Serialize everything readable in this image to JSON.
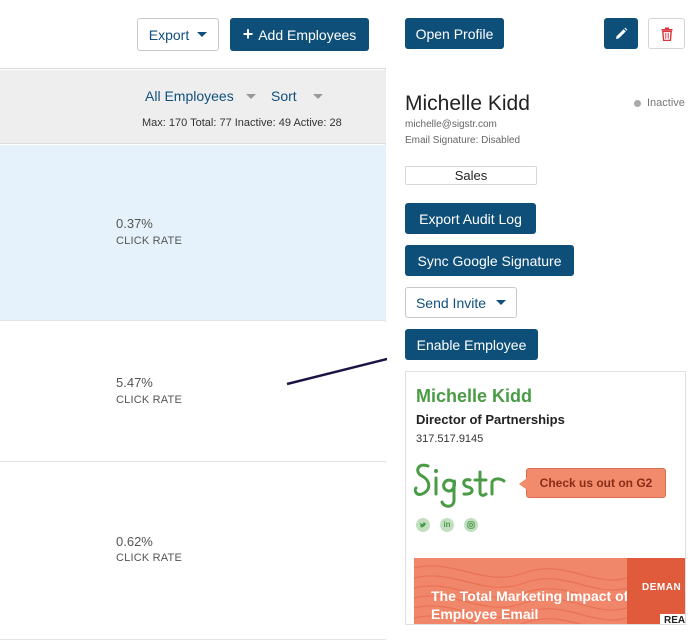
{
  "toolbar": {
    "export_label": "Export",
    "add_label": "Add Employees"
  },
  "filters": {
    "all_label": "All Employees",
    "sort_label": "Sort",
    "stats": "Max: 170  Total: 77  Inactive: 49  Active: 28"
  },
  "rows": [
    {
      "rate": "0.37%",
      "label": "CLICK RATE"
    },
    {
      "rate": "5.47%",
      "label": "CLICK RATE"
    },
    {
      "rate": "0.62%",
      "label": "CLICK RATE"
    }
  ],
  "profile": {
    "open_label": "Open Profile",
    "name": "Michelle Kidd",
    "status": "Inactive",
    "email": "michelle@sigstr.com",
    "email_signature": "Email Signature: Disabled",
    "department": "Sales",
    "export_audit_label": "Export Audit Log",
    "sync_label": "Sync Google Signature",
    "invite_label": "Send Invite",
    "enable_label": "Enable Employee"
  },
  "signature": {
    "name": "Michelle Kidd",
    "title": "Director of Partnerships",
    "phone": "317.517.9145",
    "logo_text": "Sigstr",
    "cta": "Check us out on G2",
    "banner_title": "The Total Marketing Impact of Employee Email",
    "banner_brand": "DEMAN",
    "banner_read": "REA"
  },
  "colors": {
    "primary": "#0e4f79",
    "selected_row": "#e5f2fb",
    "signature_green": "#4a9b46",
    "cta": "#f28b6c"
  }
}
